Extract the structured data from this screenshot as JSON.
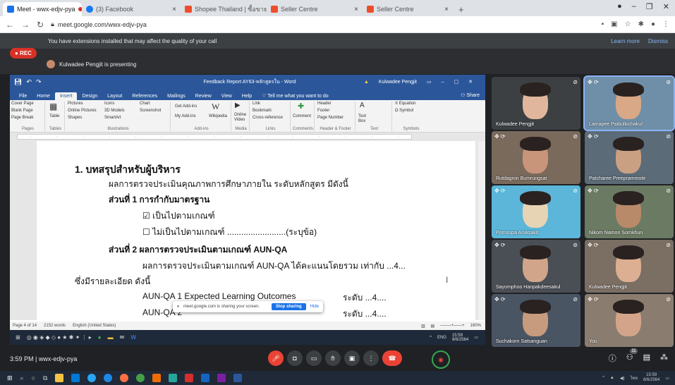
{
  "browser": {
    "tabs": [
      {
        "label": "Meet - wwx-edjv-pya",
        "color": "#1a73e8",
        "active": true
      },
      {
        "label": "(3) Facebook",
        "color": "#1877f2",
        "active": false
      },
      {
        "label": "Shopee Thailand | ซื้อขายผ่านมือถือ",
        "color": "#ee4d2d",
        "active": false
      },
      {
        "label": "Seller Centre",
        "color": "#ee4d2d",
        "active": false
      },
      {
        "label": "Seller Centre",
        "color": "#ee4d2d",
        "active": false
      }
    ],
    "url": "meet.google.com/wwx-edjv-pya",
    "tab_add": "+"
  },
  "meet": {
    "ext_banner": "You have extensions installed that may affect the quality of your call",
    "learn_more": "Learn more",
    "dismiss": "Dismiss",
    "rec": "REC",
    "presenting": "Kulwadee Pengjit is presenting",
    "share_popup": {
      "text": "meet.google.com is sharing your screen.",
      "stop": "Stop sharing",
      "hide": "Hide"
    },
    "time": "3:59 PM",
    "meeting_code": "wwx-edjv-pya",
    "participants_badge": "11"
  },
  "word": {
    "doc_title": "Feedback Report AY63-หลักสูตรใน - Word",
    "user": "Kulwadee Pengjit",
    "menu": [
      "File",
      "Home",
      "Insert",
      "Design",
      "Layout",
      "References",
      "Mailings",
      "Review",
      "View",
      "Help"
    ],
    "tell_me": "Tell me what you want to do",
    "share": "Share",
    "ribbon": {
      "pages": [
        "Cover Page",
        "Blank Page",
        "Page Break"
      ],
      "pages_label": "Pages",
      "table": "Table",
      "tables_label": "Tables",
      "illus": [
        "Pictures",
        "Online Pictures",
        "Shapes",
        "Icons",
        "3D Models",
        "SmartArt",
        "Chart",
        "Screenshot"
      ],
      "illus_label": "Illustrations",
      "addins": [
        "Get Add-ins",
        "My Add-ins",
        "Wikipedia"
      ],
      "addins_label": "Add-ins",
      "media": "Online Video",
      "media_label": "Media",
      "links": [
        "Link",
        "Bookmark",
        "Cross-reference"
      ],
      "links_label": "Links",
      "comment": "Comment",
      "comments_label": "Comments",
      "hf": [
        "Header",
        "Footer",
        "Page Number"
      ],
      "hf_label": "Header & Footer",
      "text": "Text Box",
      "text_label": "Text",
      "symbols": [
        "Equation",
        "Symbol"
      ],
      "symbols_label": "Symbols"
    },
    "document": {
      "heading": "1. บทสรุปสำหรับผู้บริหาร",
      "intro": "ผลการตรวจประเมินคุณภาพการศึกษาภายใน ระดับหลักสูตร มีดังนี้",
      "part1": "ส่วนที่ 1 การกำกับมาตรฐาน",
      "check1": "เป็นไปตามเกณฑ์",
      "check2": "ไม่เป็นไปตามเกณฑ์ .........................(ระบุข้อ)",
      "part2": "ส่วนที่ 2 ผลการตรวจประเมินตามเกณฑ์ AUN-QA",
      "result": "ผลการตรวจประเมินตามเกณฑ์ AUN-QA ได้คะแนนโดยรวม เท่ากับ ...4...",
      "detail": "ซึ่งมีรายละเอียด ดังนี้",
      "aun1": "AUN-QA 1 Expected Learning Outcomes",
      "aun1_score": "ระดับ ...4....",
      "aun2": "AUN-QA 2",
      "aun2_score": "ระดับ ...4...."
    },
    "status": {
      "page": "Page 4 of 14",
      "words": "2152 words",
      "lang": "English (United States)",
      "zoom": "160%"
    },
    "taskbar": {
      "lang": "ENG",
      "time": "15:59",
      "date": "8/6/2564"
    }
  },
  "participants": [
    {
      "name": "Kulwadee Pengjit",
      "bg": "#3c4043",
      "face": "#e0b79c"
    },
    {
      "name": "Lamapee Paibulkichakul",
      "bg": "#6f8fa8",
      "face": "#d9a886"
    },
    {
      "name": "Rutdagron Bumrungsat",
      "bg": "#7a6a5c",
      "face": "#c8957a"
    },
    {
      "name": "Patcharee Preeprammote",
      "bg": "#5c6b78",
      "face": "#caa083"
    },
    {
      "name": "Pornsupa Aruksakit",
      "bg": "#5bb6d9",
      "face": "#e7d4b4"
    },
    {
      "name": "Nikom Namon Sornkhun",
      "bg": "#6b7a63",
      "face": "#b88a6a"
    },
    {
      "name": "Sayomphoo Hanpakdeesakul",
      "bg": "#4a4f55",
      "face": "#d1a58a"
    },
    {
      "name": "Kulwadee Pengjit",
      "bg": "#7b6e63",
      "face": "#dcae92"
    },
    {
      "name": "Suchakorn Satsanguan",
      "bg": "#4a5563",
      "face": "#c79b7e"
    },
    {
      "name": "You",
      "bg": "#8a7d70",
      "face": "#d4a48a"
    }
  ],
  "os": {
    "time": "15:59",
    "date": "8/6/2564",
    "lang": "ไทย"
  }
}
